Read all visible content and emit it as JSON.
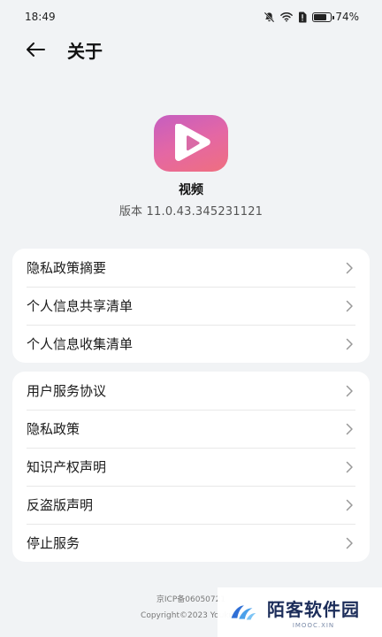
{
  "status_bar": {
    "time": "18:49",
    "battery_text": "74%",
    "battery_level": 0.74,
    "icons": [
      "mute-bell-icon",
      "wifi-icon",
      "sim-alert-icon",
      "battery-icon"
    ]
  },
  "title_bar": {
    "back_icon": "arrow-left-icon",
    "title": "关于"
  },
  "app": {
    "icon": "play-icon",
    "name": "视频",
    "version": "版本 11.0.43.345231121",
    "icon_colors": [
      "#c55ec1",
      "#e467a4",
      "#ef6f7f"
    ]
  },
  "group1": [
    {
      "label": "隐私政策摘要"
    },
    {
      "label": "个人信息共享清单"
    },
    {
      "label": "个人信息收集清单"
    }
  ],
  "group2": [
    {
      "label": "用户服务协议"
    },
    {
      "label": "隐私政策"
    },
    {
      "label": "知识产权声明"
    },
    {
      "label": "反盗版声明"
    },
    {
      "label": "停止服务"
    }
  ],
  "footer": {
    "icp": "京ICP备06050721",
    "copyright": "Copyright©2023 Youku.A"
  },
  "watermark": {
    "title": "陌客软件园",
    "subtitle": "IMOOC.XIN"
  }
}
